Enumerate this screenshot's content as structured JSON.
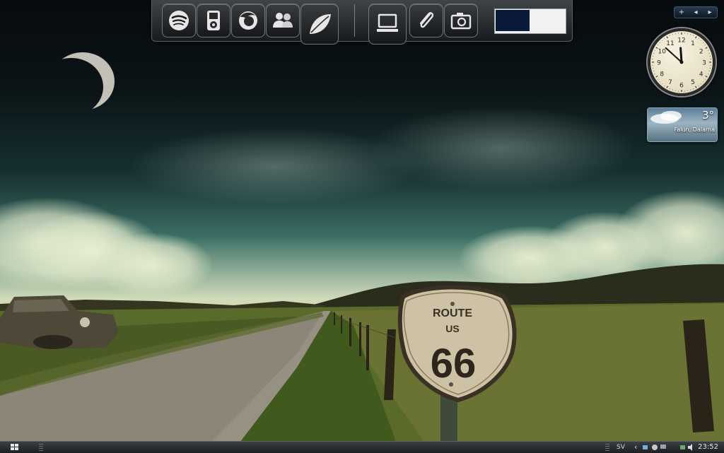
{
  "dock": {
    "apps": [
      {
        "name": "spotify-icon"
      },
      {
        "name": "ipod-icon"
      },
      {
        "name": "firefox-icon"
      },
      {
        "name": "messenger-icon"
      },
      {
        "name": "leaf-icon"
      }
    ],
    "system": [
      {
        "name": "computer-icon"
      },
      {
        "name": "paperclip-icon"
      },
      {
        "name": "camera-icon"
      }
    ]
  },
  "sidebar": {
    "add_label": "+",
    "prev_label": "◂",
    "next_label": "▸"
  },
  "clock": {
    "numbers": [
      "12",
      "1",
      "2",
      "3",
      "4",
      "5",
      "6",
      "7",
      "8",
      "9",
      "10",
      "11"
    ],
    "hour": 11,
    "minute": 52
  },
  "weather": {
    "temperature": "3°",
    "location": "Falun, Dalarna"
  },
  "sign": {
    "line1": "ROUTE",
    "line2": "US",
    "number": "66"
  },
  "taskbar": {
    "language": "SV",
    "expand_label": "‹",
    "time": "23:52"
  }
}
